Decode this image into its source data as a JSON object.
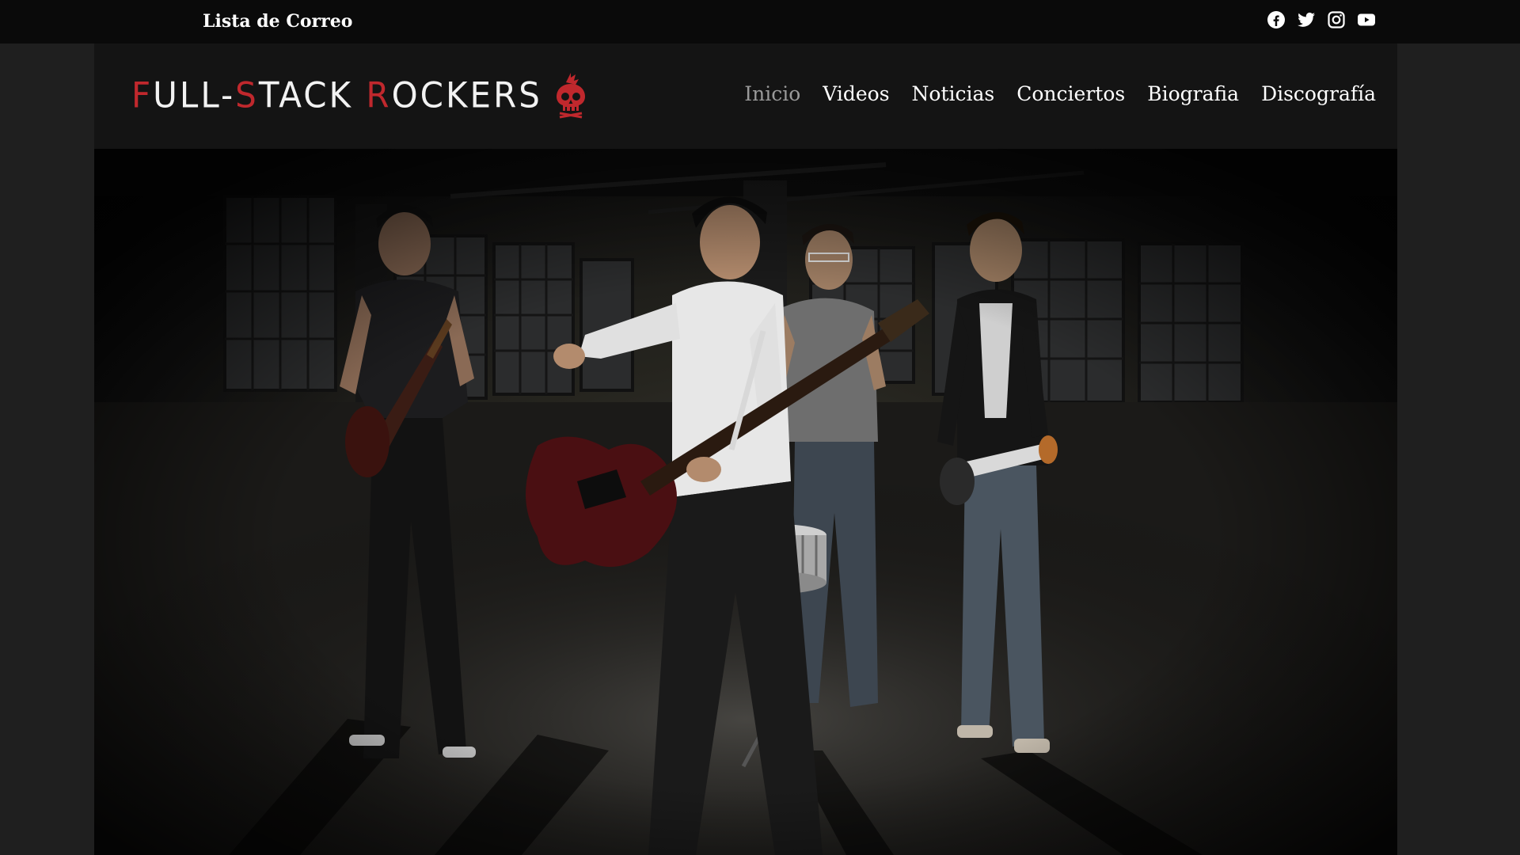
{
  "topbar": {
    "mailing_label": "Lista de Correo",
    "social_icons": [
      "facebook-icon",
      "twitter-icon",
      "instagram-icon",
      "youtube-icon"
    ]
  },
  "brand": {
    "logo_parts": {
      "f": "F",
      "ull": "ULL-",
      "s": "S",
      "tack": "TACK ",
      "r": "R",
      "ockers": "OCKERS"
    },
    "accent_color": "#c0282d"
  },
  "nav": {
    "items": [
      {
        "label": "Inicio",
        "active": true
      },
      {
        "label": "Videos",
        "active": false
      },
      {
        "label": "Noticias",
        "active": false
      },
      {
        "label": "Conciertos",
        "active": false
      },
      {
        "label": "Biografia",
        "active": false
      },
      {
        "label": "Discografía",
        "active": false
      }
    ]
  },
  "hero": {
    "image_subject": "band-photo"
  }
}
